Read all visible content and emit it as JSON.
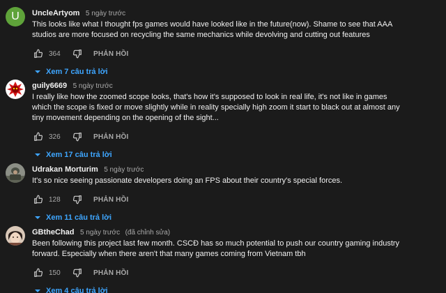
{
  "accent_color": "#3ea6ff",
  "comments": [
    {
      "author": "UncleArtyom",
      "time": "5 ngày trước",
      "edited": "",
      "avatar_letter": "U",
      "avatar_color": "#5fa33a",
      "text": "This looks like what I thought fps games would have looked like in the future(now). Shame to see that AAA studios are more focused on recycling the same mechanics while devolving and cutting out features",
      "likes": "364",
      "reply_label": "PHẢN HỒI",
      "view_replies": "Xem 7 câu trả lời"
    },
    {
      "author": "guily6669",
      "time": "5 ngày trước",
      "edited": "",
      "avatar_icon": "red-creature-avatar-icon",
      "text": "I really like how the zoomed scope looks, that's how it's supposed to look in real life, it's not like in games which the scope is fixed or move slightly while in reality specially high zoom it start to black out at almost any tiny movement depending on the opening of the sight...",
      "likes": "326",
      "reply_label": "PHẢN HỒI",
      "view_replies": "Xem 17 câu trả lời"
    },
    {
      "author": "Udrakan Morturim",
      "time": "5 ngày trước",
      "edited": "",
      "avatar_icon": "soldier-avatar-icon",
      "text": "It's so nice seeing passionate developers doing an FPS about their country's special forces.",
      "likes": "128",
      "reply_label": "PHẢN HỒI",
      "view_replies": "Xem 11 câu trả lời"
    },
    {
      "author": "GBtheChad",
      "time": "5 ngày trước",
      "edited": "(đã chỉnh sửa)",
      "avatar_icon": "anime-avatar-icon",
      "text": "Been following this project last few month. CSCĐ has so much potential to push our country gaming industry forward. Especially when there aren't that many games coming from Vietnam tbh",
      "likes": "150",
      "reply_label": "PHẢN HỒI",
      "view_replies": "Xem 4 câu trả lời"
    }
  ]
}
